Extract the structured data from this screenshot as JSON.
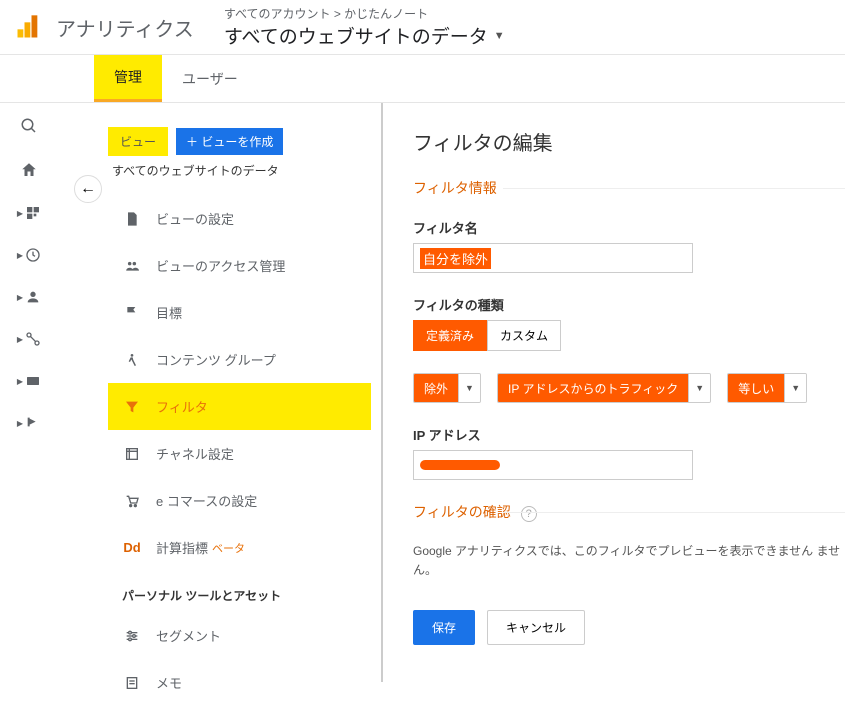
{
  "header": {
    "product": "アナリティクス",
    "breadcrumb": "すべてのアカウント > かじたんノート",
    "breadcrumb_sub": "すべてのウェブサイトのデータ"
  },
  "tabs": {
    "admin": "管理",
    "user": "ユーザー"
  },
  "admin": {
    "view_label": "ビュー",
    "create_view_btn": "＋ ビューを作成",
    "subtitle": "すべてのウェブサイトのデータ",
    "nav": {
      "view_settings": "ビューの設定",
      "view_access": "ビューのアクセス管理",
      "goals": "目標",
      "content_group": "コンテンツ グループ",
      "filter": "フィルタ",
      "channel": "チャネル設定",
      "ecommerce": "e コマースの設定",
      "calc_metrics": "計算指標",
      "beta": "ベータ",
      "personal_section": "パーソナル ツールとアセット",
      "segments": "セグメント",
      "memo": "メモ"
    }
  },
  "content": {
    "title": "フィルタの編集",
    "info_section": "フィルタ情報",
    "name_label": "フィルタ名",
    "name_value": "自分を除外",
    "type_label": "フィルタの種類",
    "type_predefined": "定義済み",
    "type_custom": "カスタム",
    "dd_exclude": "除外",
    "dd_ip_traffic": "IP アドレスからのトラフィック",
    "dd_equal": "等しい",
    "ip_label": "IP アドレス",
    "verify_label": "フィルタの確認",
    "verify_desc": "Google アナリティクスでは、このフィルタでプレビューを表示できません\nません。",
    "save": "保存",
    "cancel": "キャンセル"
  }
}
